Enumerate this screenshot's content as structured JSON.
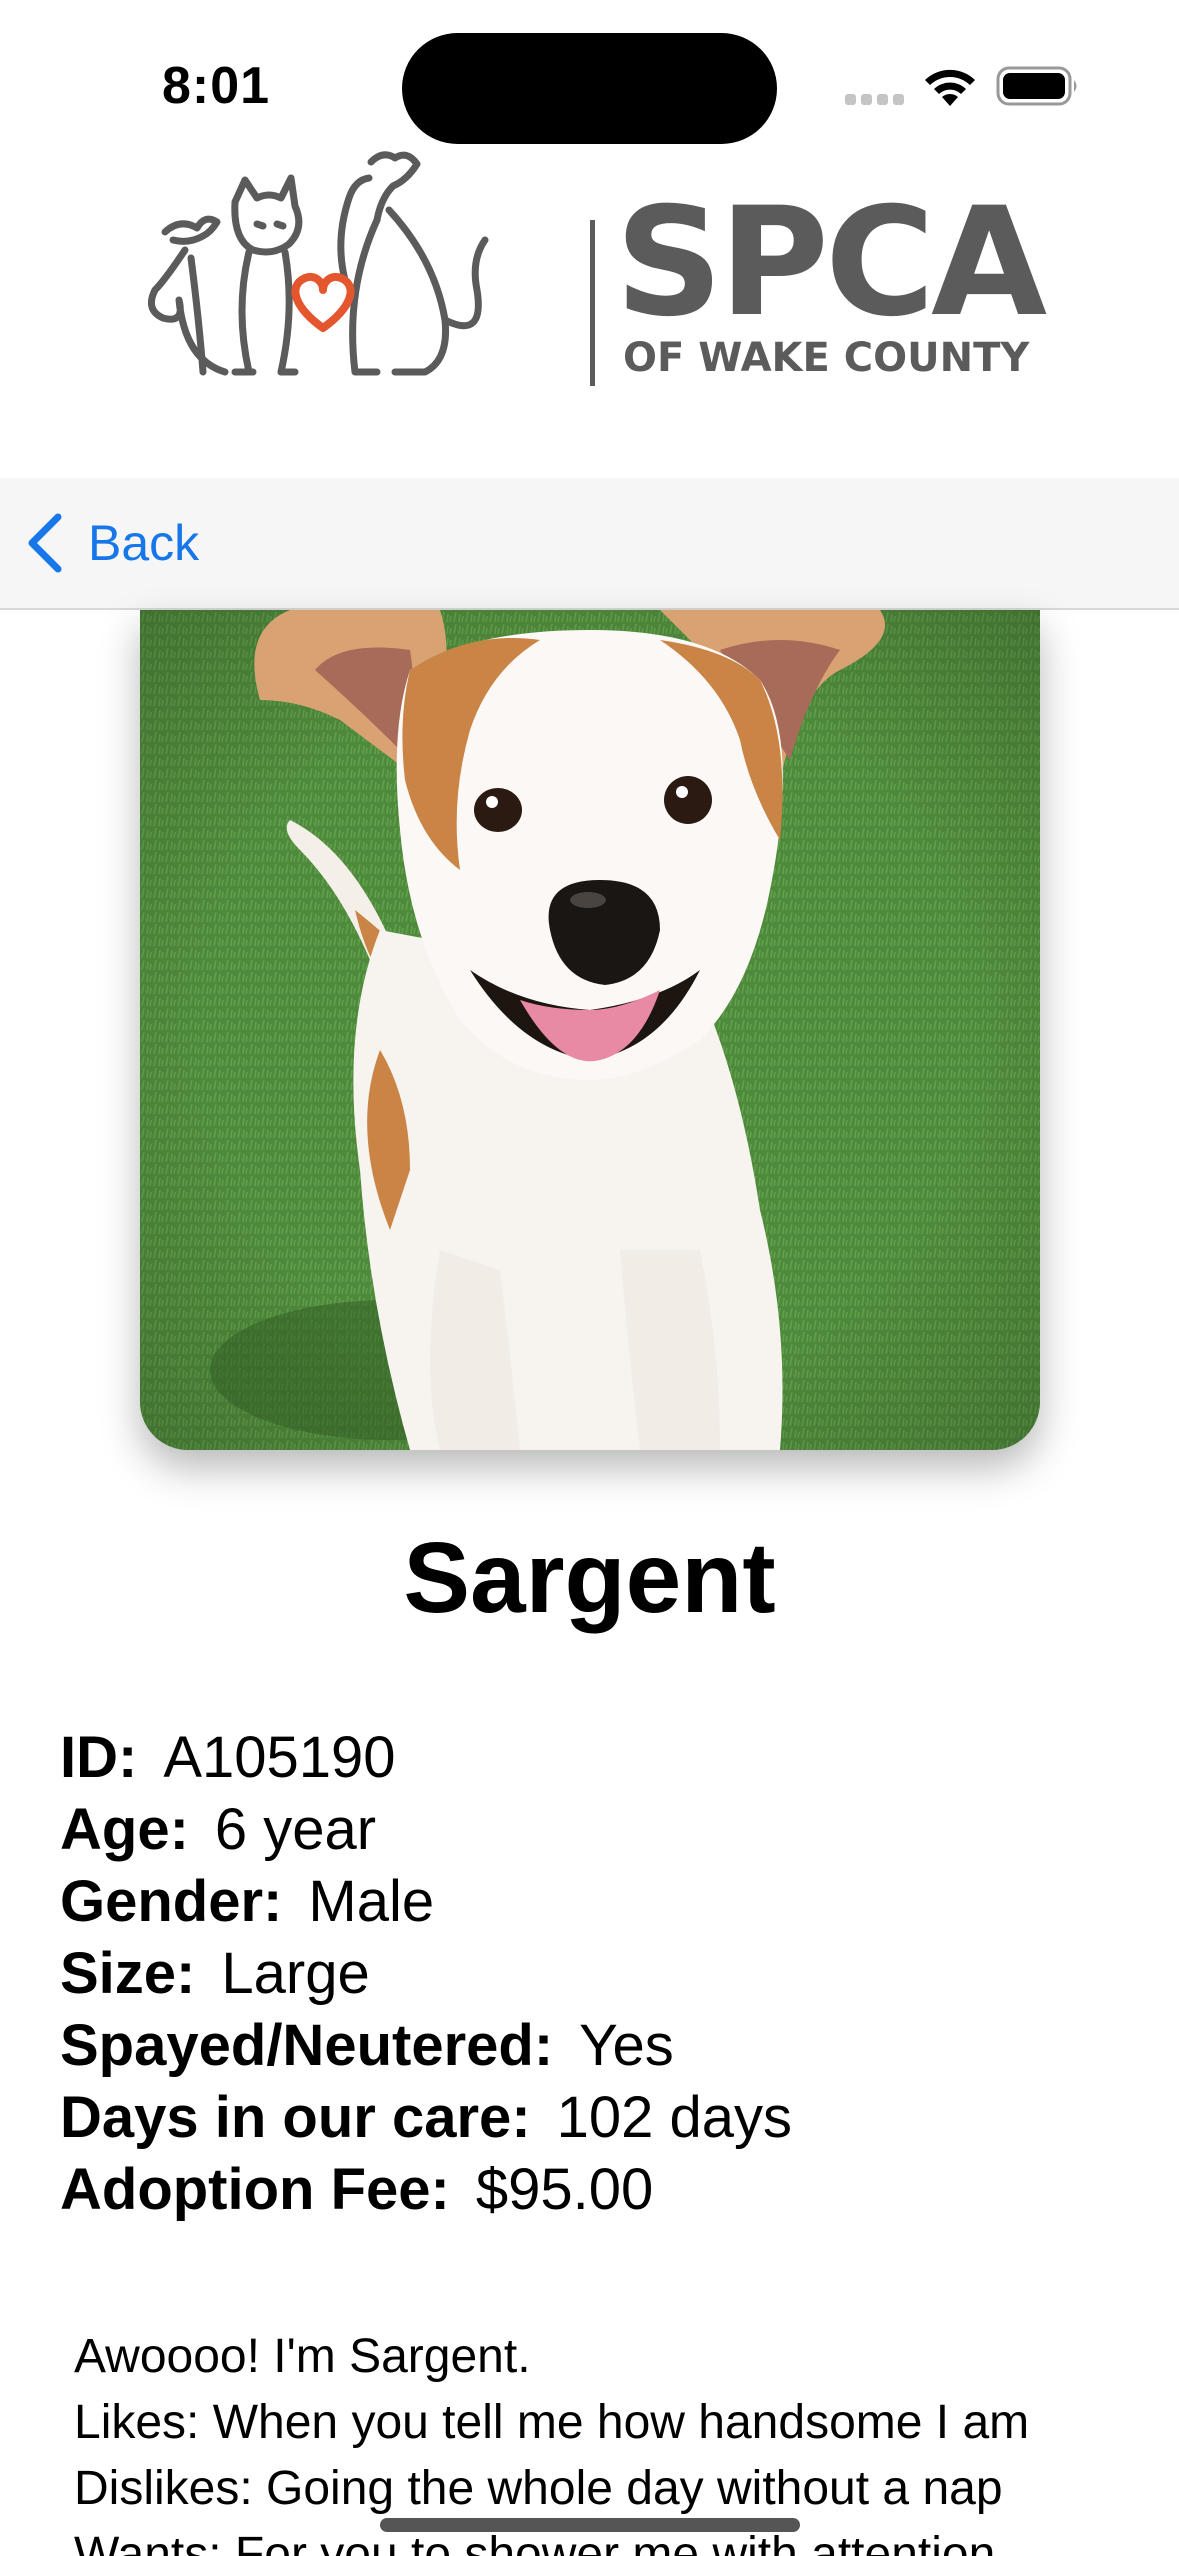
{
  "status_bar": {
    "time": "8:01"
  },
  "header": {
    "logo_main": "SPCA",
    "logo_sub": "OF WAKE COUNTY",
    "logo_accent_color": "#e4572e",
    "logo_gray_color": "#5b5b5c"
  },
  "nav": {
    "back_label": "Back",
    "accent_color": "#1877e8"
  },
  "pet": {
    "name": "Sargent",
    "photo_description_icon": "dog-photo",
    "details": [
      {
        "label": "ID:",
        "value": "A105190"
      },
      {
        "label": "Age:",
        "value": "6 year"
      },
      {
        "label": "Gender:",
        "value": "Male"
      },
      {
        "label": "Size:",
        "value": "Large"
      },
      {
        "label": "Spayed/Neutered:",
        "value": "Yes"
      },
      {
        "label": "Days in our care:",
        "value": "102 days"
      },
      {
        "label": "Adoption Fee:",
        "value": "$95.00"
      }
    ],
    "description_lines": [
      "Awoooo! I'm Sargent.",
      "Likes: When you tell me how handsome I am",
      "Dislikes: Going the whole day without a nap",
      "Wants: For you to shower me with attention"
    ]
  }
}
